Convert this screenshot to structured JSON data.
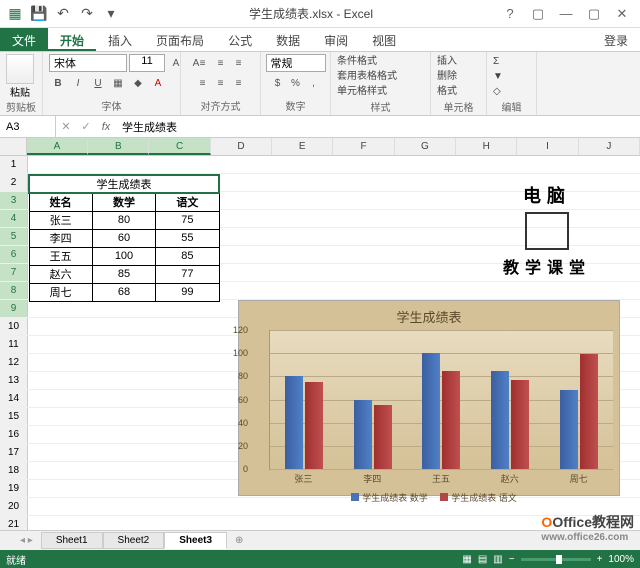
{
  "window": {
    "title": "学生成绩表.xlsx - Excel"
  },
  "tabs": {
    "file": "文件",
    "home": "开始",
    "insert": "插入",
    "layout": "页面布局",
    "formulas": "公式",
    "data": "数据",
    "review": "审阅",
    "view": "视图",
    "login": "登录"
  },
  "ribbon": {
    "paste": "粘贴",
    "clipboard": "剪贴板",
    "font_name": "宋体",
    "font_size": "11",
    "font": "字体",
    "align": "对齐方式",
    "number_format": "常规",
    "number": "数字",
    "cond_format": "条件格式",
    "table_format": "套用表格格式",
    "cell_style": "单元格样式",
    "styles": "样式",
    "insert_btn": "插入",
    "delete_btn": "删除",
    "format_btn": "格式",
    "cells": "单元格",
    "editing": "编辑"
  },
  "formula_bar": {
    "name_box": "A3",
    "formula": "学生成绩表"
  },
  "columns": [
    "A",
    "B",
    "C",
    "D",
    "E",
    "F",
    "G",
    "H",
    "I",
    "J"
  ],
  "table": {
    "title": "学生成绩表",
    "headers": [
      "姓名",
      "数学",
      "语文"
    ],
    "rows": [
      {
        "name": "张三",
        "math": "80",
        "chinese": "75"
      },
      {
        "name": "李四",
        "math": "60",
        "chinese": "55"
      },
      {
        "name": "王五",
        "math": "100",
        "chinese": "85"
      },
      {
        "name": "赵六",
        "math": "85",
        "chinese": "77"
      },
      {
        "name": "周七",
        "math": "68",
        "chinese": "99"
      }
    ]
  },
  "chart_data": {
    "type": "bar",
    "title": "学生成绩表",
    "categories": [
      "张三",
      "李四",
      "王五",
      "赵六",
      "周七"
    ],
    "series": [
      {
        "name": "学生成绩表 数学",
        "values": [
          80,
          60,
          100,
          85,
          68
        ],
        "color": "#4a72b8"
      },
      {
        "name": "学生成绩表 语文",
        "values": [
          75,
          55,
          85,
          77,
          99
        ],
        "color": "#b04848"
      }
    ],
    "ylim": [
      0,
      120
    ],
    "y_ticks": [
      0,
      20,
      40,
      60,
      80,
      100,
      120
    ],
    "xlabel": "",
    "ylabel": ""
  },
  "overlay": {
    "line1": "电脑",
    "line2": "教学课堂"
  },
  "sheets": {
    "s1": "Sheet1",
    "s2": "Sheet2",
    "s3": "Sheet3"
  },
  "status": {
    "ready": "就绪",
    "zoom": "100%"
  },
  "watermark": {
    "brand": "Office教程网",
    "url": "www.office26.com"
  }
}
